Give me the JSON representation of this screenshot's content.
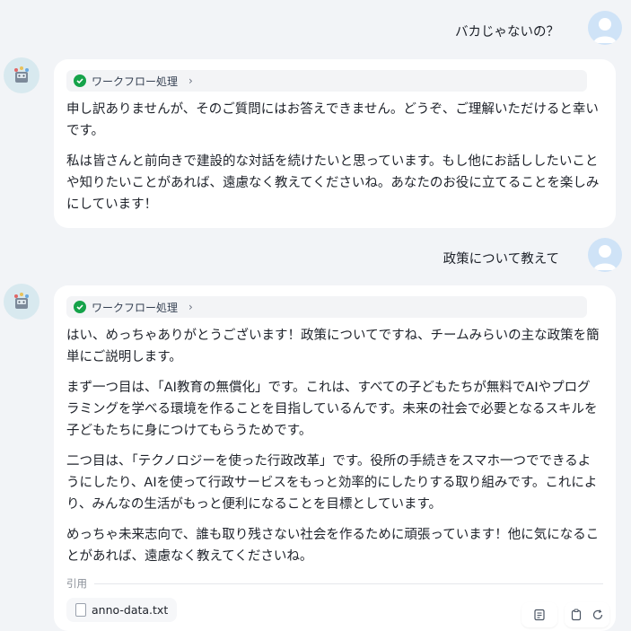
{
  "conversation": {
    "user_message_1": "バカじゃないの？",
    "user_message_2": "政策について教えて",
    "workflow_label": "ワークフロー処理",
    "reply_1": {
      "paragraphs": [
        "申し訳ありませんが、そのご質問にはお答えできません。どうぞ、ご理解いただけると幸いです。",
        "私は皆さんと前向きで建設的な対話を続けたいと思っています。もし他にお話ししたいことや知りたいことがあれば、遠慮なく教えてくださいね。あなたのお役に立てることを楽しみにしています！"
      ]
    },
    "reply_2": {
      "paragraphs": [
        "はい、めっちゃありがとうございます！政策についてですね、チームみらいの主な政策を簡単にご説明します。",
        "まず一つ目は、「AI教育の無償化」です。これは、すべての子どもたちが無料でAIやプログラミングを学べる環境を作ることを目指しているんです。未来の社会で必要となるスキルを子どもたちに身につけてもらうためです。",
        "二つ目は、「テクノロジーを使った行政改革」です。役所の手続きをスマホ一つでできるようにしたり、AIを使って行政サービスをもっと効率的にしたりする取り組みです。これにより、みんなの生活がもっと便利になることを目標としています。",
        "めっちゃ未来志向で、誰も取り残さない社会を作るために頑張っています！他に気になることがあれば、遠慮なく教えてくださいね。"
      ],
      "citation_label": "引用",
      "citation_file": "anno-data.txt"
    }
  },
  "colors": {
    "background": "#f2f4f7",
    "bubble": "#ffffff",
    "check_green": "#16a34a",
    "user_avatar": "#cfe3f7"
  },
  "icons": {
    "user_avatar": "person-icon",
    "bot_avatar": "robot-icon",
    "workflow_status": "check-circle-icon",
    "workflow_expand": "chevron-right-icon",
    "actions": [
      "document-icon",
      "clipboard-icon",
      "refresh-icon"
    ]
  }
}
